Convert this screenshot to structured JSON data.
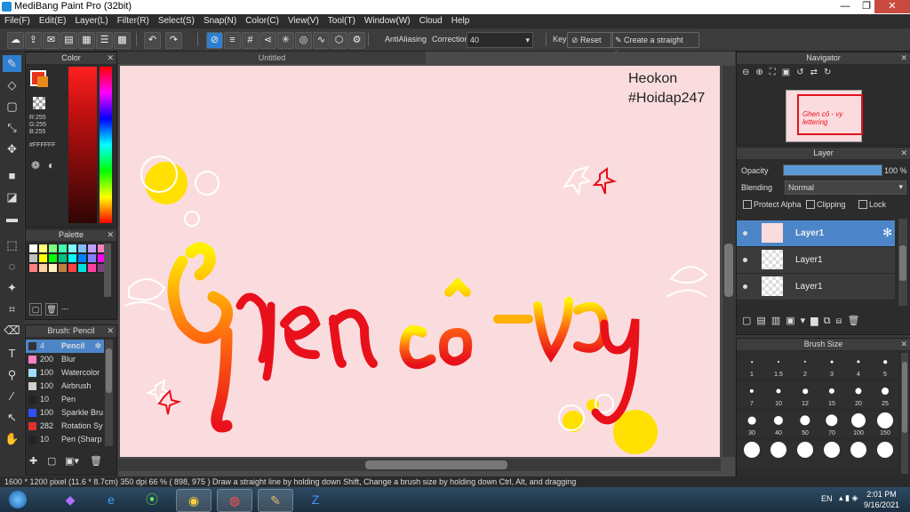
{
  "window": {
    "title": "MediBang Paint Pro (32bit)",
    "minimize": "—",
    "restore": "❐",
    "close": "✕"
  },
  "menu": [
    "File(F)",
    "Edit(E)",
    "Layer(L)",
    "Filter(R)",
    "Select(S)",
    "Snap(N)",
    "Color(C)",
    "View(V)",
    "Tool(T)",
    "Window(W)",
    "Cloud",
    "Help"
  ],
  "toolbar": {
    "antialiasing_label": "AntiAliasing",
    "correction_label": "Correction",
    "correction_value": "40",
    "key_label": "Key",
    "reset_label": "Reset",
    "straight_line_label": "Create a straight line"
  },
  "color_panel": {
    "title": "Color",
    "r": "R:255",
    "g": "G:255",
    "b": "B:255",
    "hex": "#FFFFFF",
    "fg_color": "#e8321a",
    "bg_color": "#ffffff"
  },
  "palette": {
    "title": "Palette",
    "more": "---",
    "colors": [
      "#ffffff",
      "#ffff80",
      "#80ff80",
      "#40ffb0",
      "#80ffff",
      "#80c0ff",
      "#c0a0ff",
      "#ff80c0",
      "#c0c0c0",
      "#ffff00",
      "#00ff00",
      "#00c080",
      "#00ffff",
      "#0080ff",
      "#8080ff",
      "#ff00ff",
      "#ff8080",
      "#ffd0a0",
      "#fff0c0",
      "#c08040",
      "#ff4040",
      "#00e0e0",
      "#ff40a0",
      "#804080"
    ]
  },
  "brush_panel": {
    "title": "Brush: Pencil",
    "items": [
      {
        "size": "4",
        "name": "Pencil",
        "color": "#333333"
      },
      {
        "size": "200",
        "name": "Blur",
        "color": "#ff80c0"
      },
      {
        "size": "100",
        "name": "Watercolor",
        "color": "#a0e0ff"
      },
      {
        "size": "100",
        "name": "Airbrush",
        "color": "#d0d0d0"
      },
      {
        "size": "10",
        "name": "Pen",
        "color": "#222222"
      },
      {
        "size": "100",
        "name": "Sparkle Bru",
        "color": "#3050ff"
      },
      {
        "size": "282",
        "name": "Rotation Sy",
        "color": "#e03030"
      },
      {
        "size": "10",
        "name": "Pen (Sharp",
        "color": "#222222"
      }
    ]
  },
  "canvas": {
    "tab_title": "Untitled",
    "watermark_line1": "Heokon",
    "watermark_line2": "#Hoidap247",
    "artwork_alt": "Ghen cô - vy lettering"
  },
  "navigator": {
    "title": "Navigator"
  },
  "layer_panel": {
    "title": "Layer",
    "opacity_label": "Opacity",
    "opacity_value": "100 %",
    "opacity": 1.0,
    "blending_label": "Blending",
    "blending_value": "Normal",
    "protect_alpha": "Protect Alpha",
    "clipping": "Clipping",
    "lock": "Lock",
    "layers": [
      {
        "name": "Layer1",
        "selected": true
      },
      {
        "name": "Layer1",
        "selected": false
      },
      {
        "name": "Layer1",
        "selected": false
      }
    ]
  },
  "brush_size_panel": {
    "title": "Brush Size",
    "sizes": [
      "1",
      "1.5",
      "2",
      "3",
      "4",
      "5",
      "7",
      "10",
      "12",
      "15",
      "20",
      "25",
      "30",
      "40",
      "50",
      "70",
      "100",
      "150",
      "",
      "",
      "",
      "",
      "",
      ""
    ]
  },
  "status": {
    "text": "1600 * 1200 pixel   (11.6 * 8.7cm)   350 dpi   66 %   ( 898, 975 )   Draw a straight line by holding down Shift, Change a brush size by holding down Ctrl, Alt, and dragging"
  },
  "taskbar": {
    "language": "EN",
    "time": "2:01 PM",
    "date": "9/16/2021"
  }
}
